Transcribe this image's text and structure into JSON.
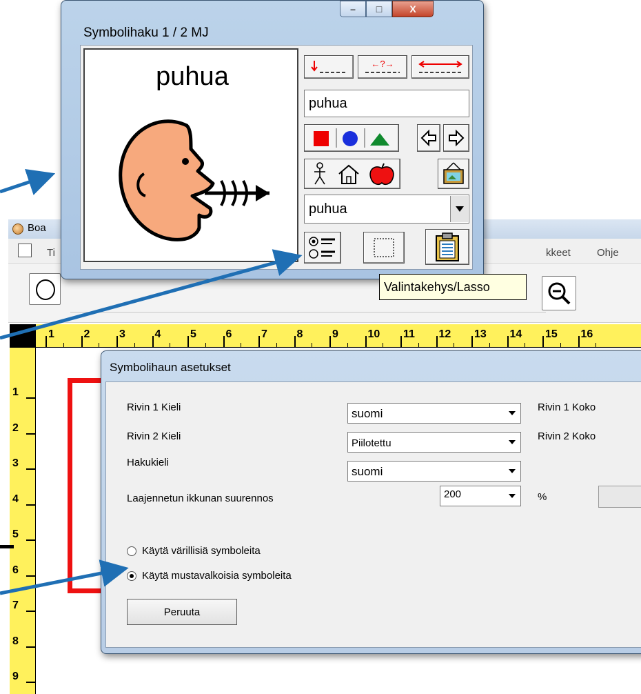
{
  "background_app": {
    "title_fragment": "Boa",
    "menu_left_fragment": "Ti",
    "menu_right": [
      "kkeet",
      "Ohje"
    ]
  },
  "ruler": {
    "h_numbers": [
      "1",
      "2",
      "3",
      "4",
      "5",
      "6",
      "7",
      "8",
      "9",
      "10",
      "11",
      "12",
      "13",
      "14",
      "15",
      "16"
    ],
    "v_numbers": [
      "1",
      "2",
      "3",
      "4",
      "5",
      "6",
      "7",
      "8",
      "9"
    ]
  },
  "symbol_search": {
    "title": "Symbolihaku  1 / 2   MJ",
    "symbol_word": "puhua",
    "search_input_value": "puhua",
    "dropdown_value": "puhua",
    "window_buttons": {
      "minimize": "–",
      "maximize": "□",
      "close": "X"
    }
  },
  "tooltip": "Valintakehys/Lasso",
  "settings": {
    "title": "Symbolihaun asetukset",
    "row1_language_label": "Rivin 1 Kieli",
    "row1_language_value": "suomi",
    "row1_size_label": "Rivin 1 Koko",
    "row2_language_label": "Rivin 2 Kieli",
    "row2_language_value": "Piilotettu",
    "row2_size_label": "Rivin 2 Koko",
    "search_language_label": "Hakukieli",
    "search_language_value": "suomi",
    "zoom_label": "Laajennetun ikkunan suurennos",
    "zoom_value": "200",
    "zoom_unit": "%",
    "radio_color_label": "Käytä värillisiä symboleita",
    "radio_bw_label": "Käytä mustavalkoisia symboleita",
    "selected_radio": "bw",
    "cancel_button": "Peruuta"
  },
  "colors": {
    "ruler": "#fff15c",
    "frame_red": "#ee1111",
    "arrow_blue": "#1f6fb4",
    "tooltip_bg": "#ffffe1"
  }
}
